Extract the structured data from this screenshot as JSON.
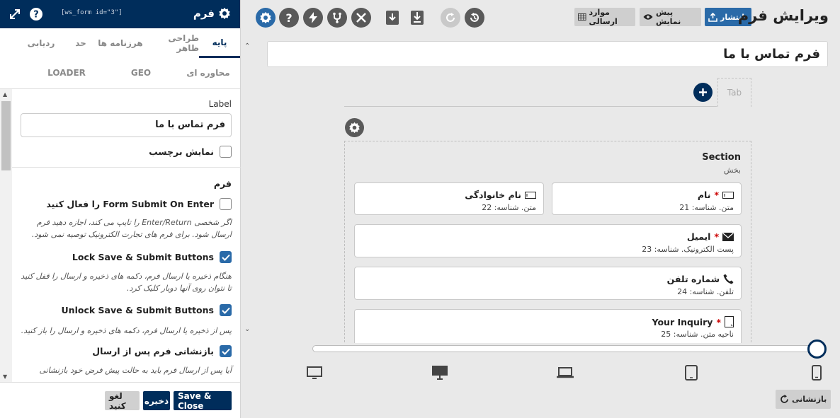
{
  "sidebar": {
    "title": "فرم",
    "shortcode": "[ws_form id=\"3\"]",
    "tabs_row1": [
      "پایه",
      "طراحی ظاهر",
      "هرزنامه ها",
      "حد",
      "ردیابی"
    ],
    "tabs_row2": [
      "محاوره ای",
      "GEO",
      "LOADER"
    ],
    "label_field": {
      "label": "Label",
      "value": "فرم تماس با ما"
    },
    "show_label": {
      "label": "نمایش برچسب",
      "checked": false
    },
    "form_section_title": "فرم",
    "options": [
      {
        "label": "Form Submit On Enter را فعال کنید",
        "checked": false,
        "help": "اگر شخصی Enter/Return را تایپ می کند، اجازه دهید فرم ارسال شود. برای فرم های تجارت الکترونیک توصیه نمی شود."
      },
      {
        "label": "Lock Save & Submit Buttons",
        "checked": true,
        "help": "هنگام ذخیره یا ارسال فرم، دکمه های ذخیره و ارسال را قفل کنید تا نتوان روی آنها دوبار کلیک کرد."
      },
      {
        "label": "Unlock Save & Submit Buttons",
        "checked": true,
        "help": "پس از ذخیره یا ارسال فرم، دکمه های ذخیره و ارسال را باز کنید."
      },
      {
        "label": "بازنشانی فرم پس از ارسال",
        "checked": true,
        "help": "آیا پس از ارسال فرم باید به حالت پیش فرض خود بازنشانی"
      }
    ],
    "footer": {
      "save_close": "Save & Close",
      "save": "ذخیره",
      "cancel": "لغو کنید"
    }
  },
  "toolbar": {
    "page_title": "ویرایش فرم",
    "publish": "انتشار",
    "preview": "پیش نمایش",
    "submissions": "موارد ارسالی"
  },
  "form_name": "فرم تماس با ما",
  "tab_placeholder": "Tab",
  "section": {
    "title": "Section",
    "subtitle": "بخش"
  },
  "fields": [
    {
      "name": "نام",
      "required": true,
      "meta": "متن. شناسه: 21",
      "icon": "text-field-icon"
    },
    {
      "name": "نام خانوادگی",
      "required": false,
      "meta": "متن. شناسه: 22",
      "icon": "text-field-icon"
    },
    {
      "name": "ایمیل",
      "required": true,
      "meta": "پست الکترونیک. شناسه: 23",
      "icon": "envelope-icon"
    },
    {
      "name": "شماره تلفن",
      "required": false,
      "meta": "تلفن. شناسه: 24",
      "icon": "phone-icon"
    },
    {
      "name": "Your Inquiry",
      "required": true,
      "meta": "ناحیه متن. شناسه: 25",
      "icon": "textarea-icon"
    }
  ],
  "breakpoints": {
    "reset": "بازنشانی"
  },
  "colors": {
    "navy": "#002d5b",
    "blue": "#2a6aa8",
    "required": "#cc0000"
  }
}
